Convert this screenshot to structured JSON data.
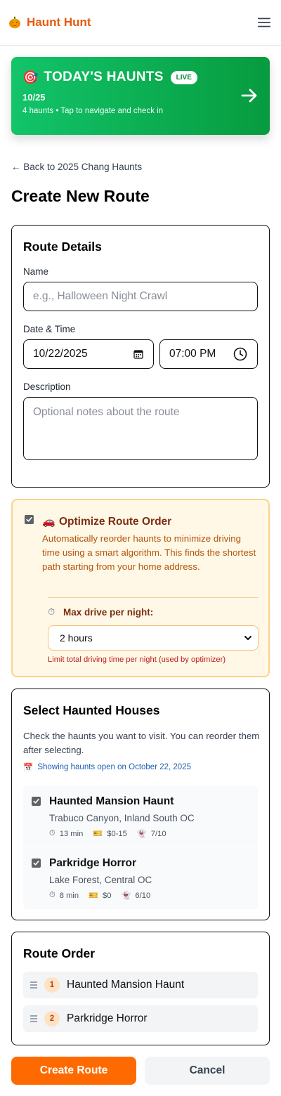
{
  "app": {
    "name": "Haunt Hunt",
    "brand_color": "#e8590c",
    "logo_icon": "pumpkin-icon",
    "menu_icon": "hamburger-menu-icon"
  },
  "banner": {
    "icon": "🎯",
    "title": "TODAY'S HAUNTS",
    "badge": "LIVE",
    "date": "10/25",
    "subtitle": "4 haunts • Tap to navigate and check in",
    "arrow_icon": "arrow-right-icon",
    "colors": [
      "#12c46a",
      "#079b3e"
    ]
  },
  "nav": {
    "back_label": "← Back to 2025 Chang Haunts"
  },
  "page": {
    "title": "Create New Route"
  },
  "route_details": {
    "title": "Route Details",
    "name_label": "Name",
    "name_placeholder": "e.g., Halloween Night Crawl",
    "datetime_label": "Date & Time",
    "date_value": "10/22/2025",
    "time_value": "07:00 PM",
    "description_label": "Description",
    "description_placeholder": "Optional notes about the route"
  },
  "optimize": {
    "checked": true,
    "icon": "🚗",
    "title": "Optimize Route Order",
    "description": "Automatically reorder haunts to minimize driving time using a smart algorithm. This finds the shortest path starting from your home address.",
    "max_drive_icon": "⏱",
    "max_drive_label": "Max drive per night:",
    "max_drive_value": "2 hours",
    "hint": "Limit total driving time per night (used by optimizer)"
  },
  "houses": {
    "title": "Select Haunted Houses",
    "description": "Check the haunts you want to visit. You can reorder them after selecting.",
    "showing_icon": "📅",
    "showing_text": "Showing haunts open on October 22, 2025",
    "items": [
      {
        "checked": true,
        "name": "Haunted Mansion Haunt",
        "location": "Trabuco Canyon, Inland South OC",
        "time": "13 min",
        "price": "$0-15",
        "rating": "7/10"
      },
      {
        "checked": true,
        "name": "Parkridge Horror",
        "location": "Lake Forest, Central OC",
        "time": "8 min",
        "price": "$0",
        "rating": "6/10"
      }
    ]
  },
  "route_order": {
    "title": "Route Order",
    "items": [
      {
        "num": "1",
        "name": "Haunted Mansion Haunt"
      },
      {
        "num": "2",
        "name": "Parkridge Horror"
      }
    ]
  },
  "actions": {
    "create_label": "Create Route",
    "cancel_label": "Cancel",
    "primary_color": "#ff6a00"
  }
}
